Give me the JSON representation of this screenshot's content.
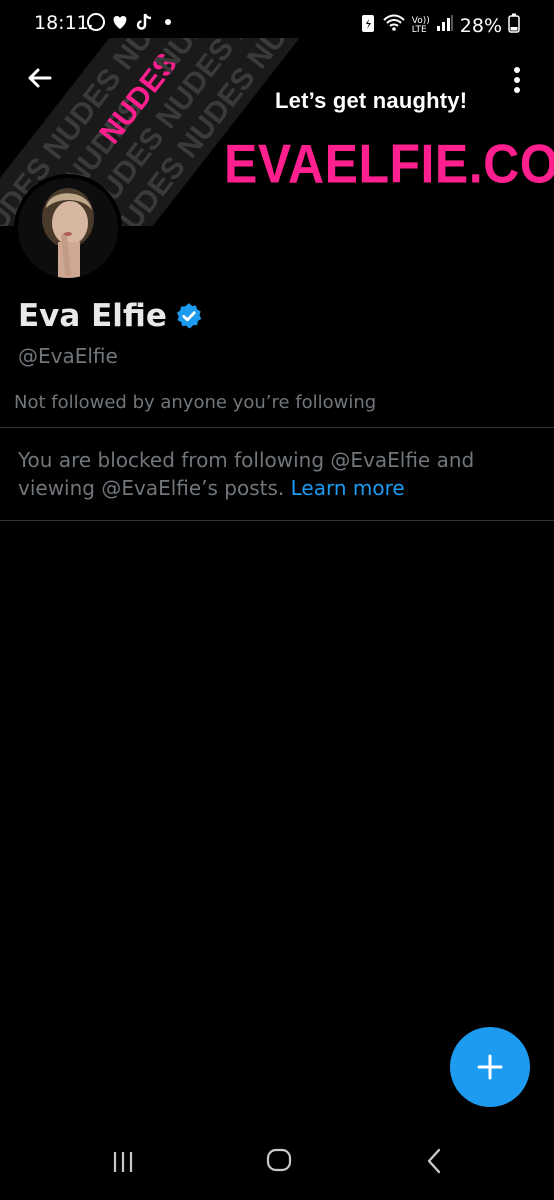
{
  "status_bar": {
    "time": "18:11",
    "battery": "28%",
    "icons": [
      "whatsapp-icon",
      "heart-icon",
      "tiktok-icon",
      "dot-icon",
      "battery-saver-icon",
      "wifi-icon",
      "volte-icon",
      "signal-icon",
      "battery-icon"
    ],
    "network_label_top": "Vo))",
    "network_label_bottom": "LTE"
  },
  "banner": {
    "tagline": "Let’s get naughty!",
    "site": "EVAELFIE.COM",
    "stripe_words": [
      "NUDES",
      "NUDES",
      "NUDES",
      "NUDES",
      "NUDES"
    ],
    "accent_color": "#ff1f8f"
  },
  "profile": {
    "display_name": "Eva Elfie",
    "handle": "@EvaElfie",
    "followers_note": "Not followed by anyone you’re following",
    "verified": true
  },
  "blocked": {
    "message": "You are blocked from following @EvaElfie and viewing @EvaElfie’s posts.",
    "learn_more": "Learn more"
  },
  "colors": {
    "accent": "#1d9bf0",
    "background": "#000000",
    "muted_text": "#71767b"
  }
}
